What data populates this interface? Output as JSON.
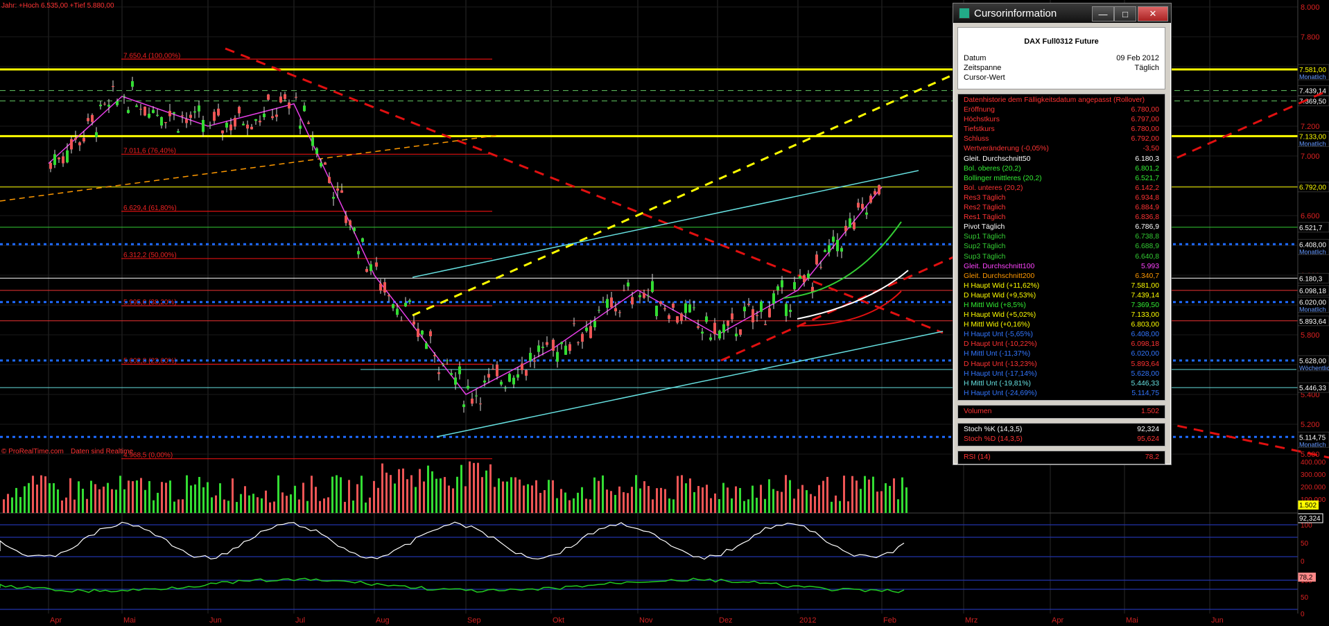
{
  "header": {
    "info": "Jahr: +Hoch 6.535,00 +Tief 5.880,00"
  },
  "watermark": {
    "brand": "© ProRealTime.com",
    "note": "Daten sind Realtime"
  },
  "colors": {
    "bg": "#000000",
    "grid": "#2a2a2a",
    "candle_up": "#33dd33",
    "candle_down": "#ee5555",
    "yellow": "#ffff00",
    "blue_dotted": "#1e6bff",
    "red_dashed": "#e01010",
    "cyan": "#66e0e0",
    "bollinger": "#33cc33",
    "ma100": "#ff44ff",
    "ma200": "#ff9900"
  },
  "chart_data": [
    {
      "type": "candlestick",
      "title": "DAX Full0312 Future",
      "x_months": [
        "Apr",
        "Mai",
        "Jun",
        "Jul",
        "Aug",
        "Sep",
        "Okt",
        "Nov",
        "Dez",
        "2012",
        "Feb",
        "Mrz",
        "Apr",
        "Mai",
        "Jun"
      ],
      "y_ticks": [
        "8.000",
        "7.800",
        "7.600",
        "7.400",
        "7.200",
        "7.000",
        "6.800",
        "6.600",
        "6.400",
        "6.200",
        "6.000",
        "5.800",
        "5.600",
        "5.400",
        "5.200",
        "5.000"
      ],
      "ylim": [
        5000,
        8000
      ],
      "horizontal_levels": [
        {
          "label": "7.581,00",
          "sub": "Monatlich",
          "color": "#ffff00",
          "value": 7581
        },
        {
          "label": "7.439,14",
          "sub": "",
          "color": "#66cc66",
          "value": 7439
        },
        {
          "label": "7.369,50",
          "sub": "",
          "color": "#66cc66",
          "value": 7369
        },
        {
          "label": "7.133,00",
          "sub": "Monatlich",
          "color": "#ffff00",
          "value": 7133
        },
        {
          "label": "6.792,00",
          "sub": "",
          "color": "#ffff00",
          "value": 6792
        },
        {
          "label": "6.521,7",
          "sub": "",
          "color": "#33cc33",
          "value": 6522
        },
        {
          "label": "6.408,00",
          "sub": "Monatlich",
          "color": "#1e6bff",
          "value": 6408
        },
        {
          "label": "6.180,3",
          "sub": "",
          "color": "#ffffff",
          "value": 6180
        },
        {
          "label": "6.098,18",
          "sub": "",
          "color": "#ee3333",
          "value": 6098
        },
        {
          "label": "6.020,00",
          "sub": "Monatlich",
          "color": "#1e6bff",
          "value": 6020
        },
        {
          "label": "5.893,64",
          "sub": "",
          "color": "#ee3333",
          "value": 5894
        },
        {
          "label": "5.628,00",
          "sub": "Wöchentlich",
          "color": "#1e6bff",
          "value": 5628
        },
        {
          "label": "5.446,33",
          "sub": "",
          "color": "#66e0e0",
          "value": 5446
        },
        {
          "label": "5.114,75",
          "sub": "Monatlich",
          "color": "#1e6bff",
          "value": 5115
        }
      ],
      "fibonacci": [
        {
          "label": "7.650,4 (100,00%)",
          "value": 7650
        },
        {
          "label": "7.011,6 (76,40%)",
          "value": 7012
        },
        {
          "label": "6.629,4 (61,80%)",
          "value": 6629
        },
        {
          "label": "6.312,2 (50,00%)",
          "value": 6312
        },
        {
          "label": "5.995,0 (38,20%)",
          "value": 5995
        },
        {
          "label": "5.602,8 (23,60%)",
          "value": 5603
        },
        {
          "label": "4.968,5 (0,00%)",
          "value": 4969
        }
      ],
      "close_samples": [
        {
          "x": "Apr",
          "y": 6950
        },
        {
          "x": "Mai",
          "y": 7400
        },
        {
          "x": "Jun",
          "y": 7200
        },
        {
          "x": "Jul",
          "y": 7350
        },
        {
          "x": "Aug",
          "y": 6200
        },
        {
          "x": "Sep",
          "y": 5400
        },
        {
          "x": "Okt",
          "y": 5700
        },
        {
          "x": "Nov",
          "y": 6100
        },
        {
          "x": "Dez",
          "y": 5800
        },
        {
          "x": "2012",
          "y": 6100
        },
        {
          "x": "Feb",
          "y": 6792
        }
      ]
    },
    {
      "type": "bar",
      "title": "Volumen",
      "y_ticks": [
        "400.000",
        "300.000",
        "200.000",
        "100.000"
      ],
      "last_value": "1.502"
    },
    {
      "type": "line",
      "title": "Stoch %K (14,3,5)",
      "y_ticks": [
        "100",
        "50",
        "0"
      ],
      "last_value": "92,324"
    },
    {
      "type": "line",
      "title": "RSI (14)",
      "y_ticks": [
        "100",
        "50",
        "0"
      ],
      "last_value": "78,2"
    }
  ],
  "cursor_window": {
    "title": "Cursorinformation",
    "buttons": {
      "minimize": "—",
      "maximize": "□",
      "close": "✕"
    },
    "instrument": "DAX Full0312 Future",
    "datum_label": "Datum",
    "datum_value": "09 Feb 2012",
    "zeitspanne_label": "Zeitspanne",
    "zeitspanne_value": "Täglich",
    "cursor_label": "Cursor-Wert",
    "rows": [
      {
        "label": "Datenhistorie dem Fälligkeitsdatum angepasst (Rollover)",
        "value": "",
        "color": "#ff3333"
      },
      {
        "label": "Eröffnung",
        "value": "6.780,00",
        "color": "#ff3333"
      },
      {
        "label": "Höchstkurs",
        "value": "6.797,00",
        "color": "#ff3333"
      },
      {
        "label": "Tiefstkurs",
        "value": "6.780,00",
        "color": "#ff3333"
      },
      {
        "label": "Schluss",
        "value": "6.792,00",
        "color": "#ff3333"
      },
      {
        "label": "Wertveränderung (-0,05%)",
        "value": "-3,50",
        "color": "#ff3333"
      },
      {
        "label": "Gleit. Durchschnitt50",
        "value": "6.180,3",
        "color": "#ffffff"
      },
      {
        "label": "Bol. oberes (20,2)",
        "value": "6.801,2",
        "color": "#33ee33"
      },
      {
        "label": "Bollinger mittleres (20,2)",
        "value": "6.521,7",
        "color": "#33ee33"
      },
      {
        "label": "Bol. unteres (20,2)",
        "value": "6.142,2",
        "color": "#ff3333"
      },
      {
        "label": "Res3 Täglich",
        "value": "6.934,8",
        "color": "#ff3333"
      },
      {
        "label": "Res2 Täglich",
        "value": "6.884,9",
        "color": "#ff3333"
      },
      {
        "label": "Res1 Täglich",
        "value": "6.836,8",
        "color": "#ff3333"
      },
      {
        "label": "Pivot Täglich",
        "value": "6.786,9",
        "color": "#ffffff"
      },
      {
        "label": "Sup1 Täglich",
        "value": "6.738,8",
        "color": "#33cc33"
      },
      {
        "label": "Sup2 Täglich",
        "value": "6.688,9",
        "color": "#33cc33"
      },
      {
        "label": "Sup3 Täglich",
        "value": "6.640,8",
        "color": "#33cc33"
      },
      {
        "label": "Gleit. Durchschnitt100",
        "value": "5.993",
        "color": "#ff44ff"
      },
      {
        "label": "Gleit. Durchschnitt200",
        "value": "6.340,7",
        "color": "#ff9900"
      },
      {
        "label": "H Haupt Wid (+11,62%)",
        "value": "7.581,00",
        "color": "#ffff00"
      },
      {
        "label": "D Haupt Wid (+9,53%)",
        "value": "7.439,14",
        "color": "#ffff00"
      },
      {
        "label": "H Mittl Wid (+8,5%)",
        "value": "7.369,50",
        "color": "#33ee33"
      },
      {
        "label": "H Haupt Wid (+5,02%)",
        "value": "7.133,00",
        "color": "#ffff00"
      },
      {
        "label": "H Mittl Wid (+0,16%)",
        "value": "6.803,00",
        "color": "#ffff00"
      },
      {
        "label": "H Haupt Unt (-5,65%)",
        "value": "6.408,00",
        "color": "#3377ff"
      },
      {
        "label": "D Haupt Unt (-10,22%)",
        "value": "6.098,18",
        "color": "#ff3333"
      },
      {
        "label": "H Mittl Unt (-11,37%)",
        "value": "6.020,00",
        "color": "#3377ff"
      },
      {
        "label": "D Haupt Unt (-13,23%)",
        "value": "5.893,64",
        "color": "#ff3333"
      },
      {
        "label": "H Haupt Unt (-17,14%)",
        "value": "5.628,00",
        "color": "#3377ff"
      },
      {
        "label": "H Mittl Unt (-19,81%)",
        "value": "5.446,33",
        "color": "#66e0e0"
      },
      {
        "label": "H Haupt Unt (-24,69%)",
        "value": "5.114,75",
        "color": "#3377ff"
      }
    ],
    "volumen_label": "Volumen",
    "volumen_value": "1.502",
    "stoch_k_label": "Stoch %K (14,3,5)",
    "stoch_k_value": "92,324",
    "stoch_d_label": "Stoch %D (14,3,5)",
    "stoch_d_value": "95,624",
    "rsi_label": "RSI (14)",
    "rsi_value": "78,2"
  }
}
